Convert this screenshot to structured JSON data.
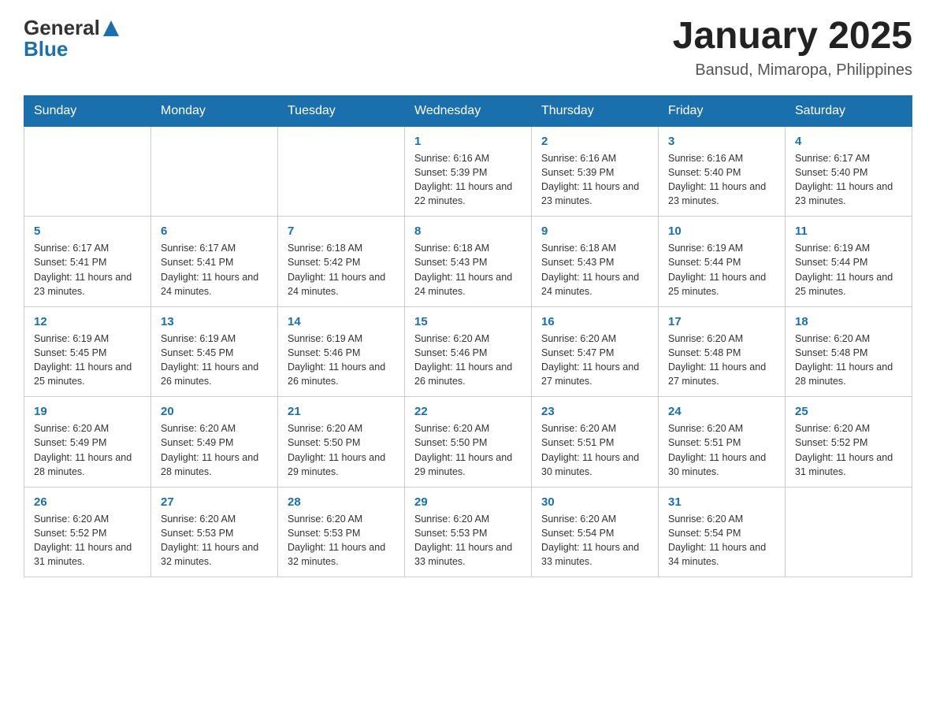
{
  "header": {
    "logo_text_part1": "General",
    "logo_text_part2": "Blue",
    "calendar_title": "January 2025",
    "calendar_subtitle": "Bansud, Mimaropa, Philippines"
  },
  "weekdays": [
    "Sunday",
    "Monday",
    "Tuesday",
    "Wednesday",
    "Thursday",
    "Friday",
    "Saturday"
  ],
  "weeks": [
    {
      "days": [
        {
          "num": "",
          "info": ""
        },
        {
          "num": "",
          "info": ""
        },
        {
          "num": "",
          "info": ""
        },
        {
          "num": "1",
          "info": "Sunrise: 6:16 AM\nSunset: 5:39 PM\nDaylight: 11 hours and 22 minutes."
        },
        {
          "num": "2",
          "info": "Sunrise: 6:16 AM\nSunset: 5:39 PM\nDaylight: 11 hours and 23 minutes."
        },
        {
          "num": "3",
          "info": "Sunrise: 6:16 AM\nSunset: 5:40 PM\nDaylight: 11 hours and 23 minutes."
        },
        {
          "num": "4",
          "info": "Sunrise: 6:17 AM\nSunset: 5:40 PM\nDaylight: 11 hours and 23 minutes."
        }
      ]
    },
    {
      "days": [
        {
          "num": "5",
          "info": "Sunrise: 6:17 AM\nSunset: 5:41 PM\nDaylight: 11 hours and 23 minutes."
        },
        {
          "num": "6",
          "info": "Sunrise: 6:17 AM\nSunset: 5:41 PM\nDaylight: 11 hours and 24 minutes."
        },
        {
          "num": "7",
          "info": "Sunrise: 6:18 AM\nSunset: 5:42 PM\nDaylight: 11 hours and 24 minutes."
        },
        {
          "num": "8",
          "info": "Sunrise: 6:18 AM\nSunset: 5:43 PM\nDaylight: 11 hours and 24 minutes."
        },
        {
          "num": "9",
          "info": "Sunrise: 6:18 AM\nSunset: 5:43 PM\nDaylight: 11 hours and 24 minutes."
        },
        {
          "num": "10",
          "info": "Sunrise: 6:19 AM\nSunset: 5:44 PM\nDaylight: 11 hours and 25 minutes."
        },
        {
          "num": "11",
          "info": "Sunrise: 6:19 AM\nSunset: 5:44 PM\nDaylight: 11 hours and 25 minutes."
        }
      ]
    },
    {
      "days": [
        {
          "num": "12",
          "info": "Sunrise: 6:19 AM\nSunset: 5:45 PM\nDaylight: 11 hours and 25 minutes."
        },
        {
          "num": "13",
          "info": "Sunrise: 6:19 AM\nSunset: 5:45 PM\nDaylight: 11 hours and 26 minutes."
        },
        {
          "num": "14",
          "info": "Sunrise: 6:19 AM\nSunset: 5:46 PM\nDaylight: 11 hours and 26 minutes."
        },
        {
          "num": "15",
          "info": "Sunrise: 6:20 AM\nSunset: 5:46 PM\nDaylight: 11 hours and 26 minutes."
        },
        {
          "num": "16",
          "info": "Sunrise: 6:20 AM\nSunset: 5:47 PM\nDaylight: 11 hours and 27 minutes."
        },
        {
          "num": "17",
          "info": "Sunrise: 6:20 AM\nSunset: 5:48 PM\nDaylight: 11 hours and 27 minutes."
        },
        {
          "num": "18",
          "info": "Sunrise: 6:20 AM\nSunset: 5:48 PM\nDaylight: 11 hours and 28 minutes."
        }
      ]
    },
    {
      "days": [
        {
          "num": "19",
          "info": "Sunrise: 6:20 AM\nSunset: 5:49 PM\nDaylight: 11 hours and 28 minutes."
        },
        {
          "num": "20",
          "info": "Sunrise: 6:20 AM\nSunset: 5:49 PM\nDaylight: 11 hours and 28 minutes."
        },
        {
          "num": "21",
          "info": "Sunrise: 6:20 AM\nSunset: 5:50 PM\nDaylight: 11 hours and 29 minutes."
        },
        {
          "num": "22",
          "info": "Sunrise: 6:20 AM\nSunset: 5:50 PM\nDaylight: 11 hours and 29 minutes."
        },
        {
          "num": "23",
          "info": "Sunrise: 6:20 AM\nSunset: 5:51 PM\nDaylight: 11 hours and 30 minutes."
        },
        {
          "num": "24",
          "info": "Sunrise: 6:20 AM\nSunset: 5:51 PM\nDaylight: 11 hours and 30 minutes."
        },
        {
          "num": "25",
          "info": "Sunrise: 6:20 AM\nSunset: 5:52 PM\nDaylight: 11 hours and 31 minutes."
        }
      ]
    },
    {
      "days": [
        {
          "num": "26",
          "info": "Sunrise: 6:20 AM\nSunset: 5:52 PM\nDaylight: 11 hours and 31 minutes."
        },
        {
          "num": "27",
          "info": "Sunrise: 6:20 AM\nSunset: 5:53 PM\nDaylight: 11 hours and 32 minutes."
        },
        {
          "num": "28",
          "info": "Sunrise: 6:20 AM\nSunset: 5:53 PM\nDaylight: 11 hours and 32 minutes."
        },
        {
          "num": "29",
          "info": "Sunrise: 6:20 AM\nSunset: 5:53 PM\nDaylight: 11 hours and 33 minutes."
        },
        {
          "num": "30",
          "info": "Sunrise: 6:20 AM\nSunset: 5:54 PM\nDaylight: 11 hours and 33 minutes."
        },
        {
          "num": "31",
          "info": "Sunrise: 6:20 AM\nSunset: 5:54 PM\nDaylight: 11 hours and 34 minutes."
        },
        {
          "num": "",
          "info": ""
        }
      ]
    }
  ]
}
